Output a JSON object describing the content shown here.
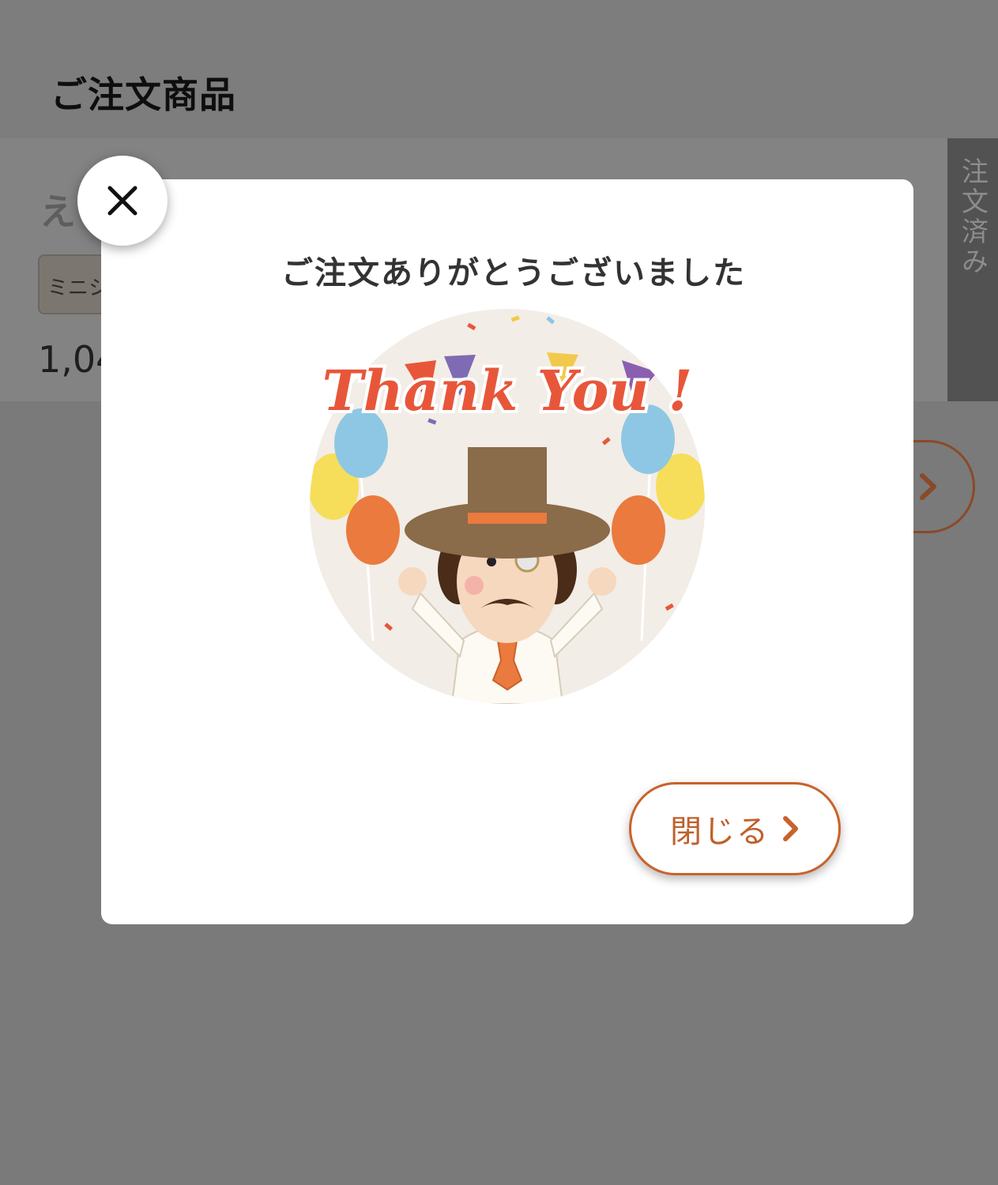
{
  "page": {
    "section_title": "ご注文商品",
    "item_name_partial": "え",
    "item_tag_partial": "ミニシロ",
    "item_price_partial": "1,04",
    "ordered_badge": "注文済み"
  },
  "modal": {
    "title": "ご注文ありがとうございました",
    "illustration_text": "Thank You !",
    "close_button_label": "閉じる"
  },
  "colors": {
    "accent": "#c9622a",
    "overlay": "#7a7a7a"
  },
  "icons": {
    "close": "close-icon",
    "chevron": "chevron-right-icon"
  }
}
